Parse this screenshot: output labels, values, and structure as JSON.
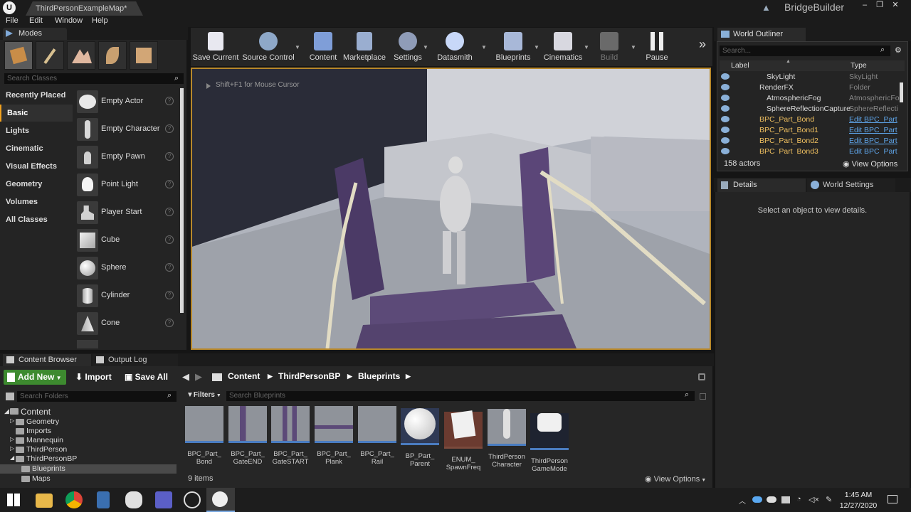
{
  "window": {
    "tab_title": "ThirdPersonExampleMap*",
    "project_name": "BridgeBuilder",
    "logo": "U",
    "controls": {
      "minimize": "–",
      "maximize": "❐",
      "close": "✕"
    }
  },
  "menu": [
    "File",
    "Edit",
    "Window",
    "Help"
  ],
  "modes": {
    "tab_label": "Modes",
    "search_placeholder": "Search Classes",
    "categories": [
      "Recently Placed",
      "Basic",
      "Lights",
      "Cinematic",
      "Visual Effects",
      "Geometry",
      "Volumes",
      "All Classes"
    ],
    "selected_category": "Basic",
    "items": [
      "Empty Actor",
      "Empty Character",
      "Empty Pawn",
      "Point Light",
      "Player Start",
      "Cube",
      "Sphere",
      "Cylinder",
      "Cone"
    ],
    "help_glyph": "?"
  },
  "toolbar": {
    "buttons": [
      "Save Current",
      "Source Control",
      "Content",
      "Marketplace",
      "Settings",
      "Datasmith",
      "Blueprints",
      "Cinematics",
      "Build",
      "Pause"
    ],
    "more_glyph": "»"
  },
  "viewport": {
    "hint": "Shift+F1 for Mouse Cursor"
  },
  "world_outliner": {
    "tab_label": "World Outliner",
    "search_placeholder": "Search...",
    "col_label": "Label",
    "col_type": "Type",
    "rows": [
      {
        "name": "SkyLight",
        "type": "SkyLight"
      },
      {
        "name": "RenderFX",
        "type": "Folder"
      },
      {
        "name": "AtmosphericFog",
        "type": "AtmosphericFo"
      },
      {
        "name": "SphereReflectionCapture",
        "type": "SphereReflecti"
      },
      {
        "name": "BPC_Part_Bond",
        "type": "Edit BPC_Part"
      },
      {
        "name": "BPC_Part_Bond1",
        "type": "Edit BPC_Part"
      },
      {
        "name": "BPC_Part_Bond2",
        "type": "Edit BPC_Part"
      },
      {
        "name": "BPC_Part_Bond3",
        "type": "Edit BPC_Part"
      }
    ],
    "actor_count": "158 actors",
    "view_options": "View Options"
  },
  "details": {
    "tab_label": "Details",
    "world_settings_label": "World Settings",
    "empty_message": "Select an object to view details."
  },
  "content_browser": {
    "tab_label": "Content Browser",
    "output_log_label": "Output Log",
    "add_new": "Add New",
    "import": "Import",
    "save_all": "Save All",
    "breadcrumb": [
      "Content",
      "ThirdPersonBP",
      "Blueprints"
    ],
    "search_folders_placeholder": "Search Folders",
    "filters_label": "Filters",
    "search_blueprints_placeholder": "Search Blueprints",
    "tree": [
      "Content",
      "Geometry",
      "Imports",
      "Mannequin",
      "ThirdPerson",
      "ThirdPersonBP",
      "Blueprints",
      "Maps"
    ],
    "assets": [
      {
        "line1": "BPC_Part_",
        "line2": "Bond"
      },
      {
        "line1": "BPC_Part_",
        "line2": "GateEND"
      },
      {
        "line1": "BPC_Part_",
        "line2": "GateSTART"
      },
      {
        "line1": "BPC_Part_",
        "line2": "Plank"
      },
      {
        "line1": "BPC_Part_",
        "line2": "Rail"
      },
      {
        "line1": "BP_Part_",
        "line2": "Parent"
      },
      {
        "line1": "ENUM_",
        "line2": "SpawnFreq"
      },
      {
        "line1": "ThirdPerson",
        "line2": "Character"
      },
      {
        "line1": "ThirdPerson",
        "line2": "GameMode"
      }
    ],
    "items_count": "9 items",
    "view_options": "View Options"
  },
  "taskbar": {
    "time": "1:45 AM",
    "date": "12/27/2020"
  },
  "colors": {
    "accent_orange": "#f1a11e",
    "add_new_green": "#3d8a2f",
    "link_blue": "#5ea4e8",
    "viewport_border": "#b8882a"
  }
}
